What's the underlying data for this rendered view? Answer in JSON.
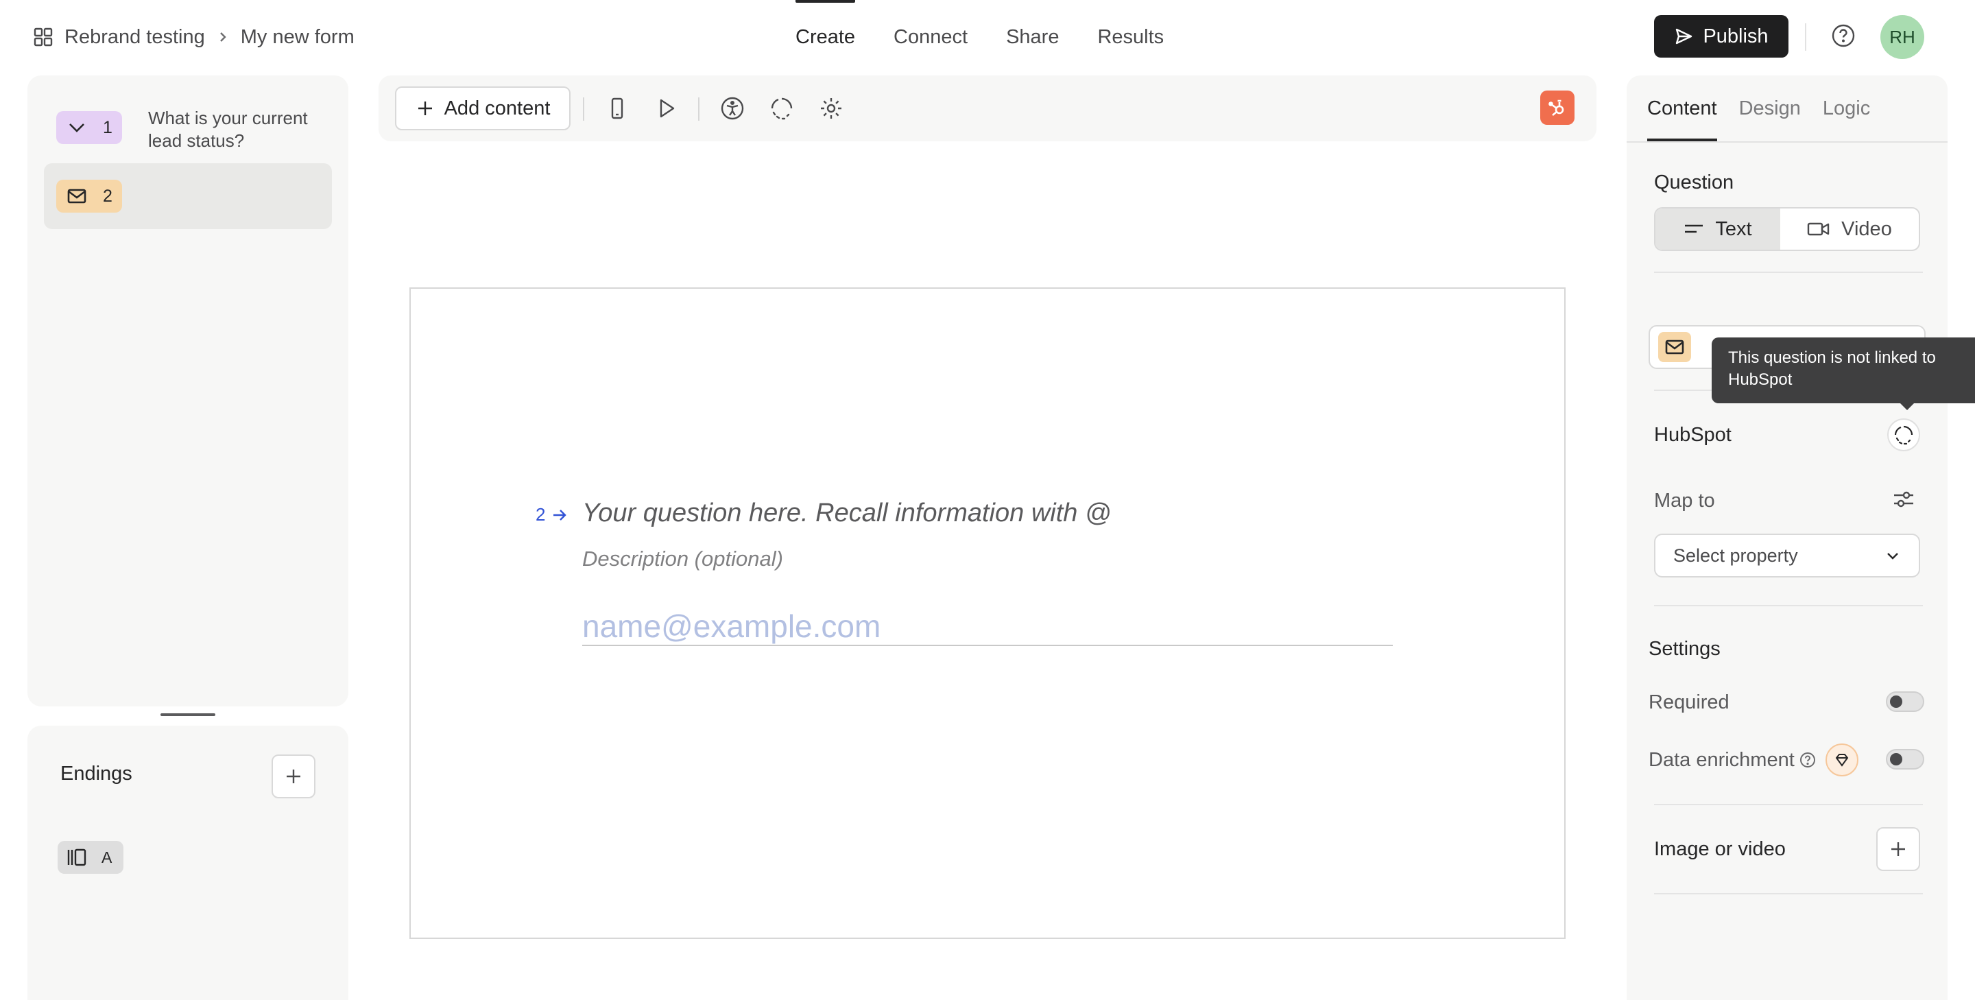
{
  "header": {
    "breadcrumb": {
      "workspace": "Rebrand testing",
      "form": "My new form"
    },
    "tabs": [
      {
        "label": "Create",
        "active": true
      },
      {
        "label": "Connect",
        "active": false
      },
      {
        "label": "Share",
        "active": false
      },
      {
        "label": "Results",
        "active": false
      }
    ],
    "publish_label": "Publish",
    "avatar_initials": "RH"
  },
  "questions": [
    {
      "number": "1",
      "text": "What is your current lead status?",
      "type_icon": "chevron-down-icon",
      "color": "#e5d0f5"
    },
    {
      "number": "2",
      "text": "",
      "type_icon": "mail-icon",
      "color": "#f7d7a8",
      "selected": true
    }
  ],
  "endings": {
    "title": "Endings",
    "items": [
      {
        "label": "A",
        "icon": "ending-icon"
      }
    ]
  },
  "toolbar": {
    "add_content_label": "Add content",
    "icons": [
      "mobile-icon",
      "play-icon",
      "accessibility-icon",
      "unlink-icon",
      "settings-icon",
      "hubspot-icon"
    ]
  },
  "canvas": {
    "question_number": "2",
    "question_placeholder": "Your question here. Recall information with @",
    "description_placeholder": "Description (optional)",
    "answer_placeholder": "name@example.com"
  },
  "right_panel": {
    "tabs": [
      {
        "label": "Content",
        "active": true
      },
      {
        "label": "Design",
        "active": false
      },
      {
        "label": "Logic",
        "active": false
      }
    ],
    "question_label": "Question",
    "question_modes": [
      {
        "label": "Text",
        "selected": true
      },
      {
        "label": "Video",
        "selected": false
      }
    ],
    "hubspot_label": "HubSpot",
    "map_to_label": "Map to",
    "select_placeholder": "Select property",
    "settings_label": "Settings",
    "required_label": "Required",
    "required_on": false,
    "data_enrichment_label": "Data enrichment",
    "data_enrichment_on": false,
    "image_video_label": "Image or video",
    "tooltip": "This question is not linked to HubSpot"
  },
  "colors": {
    "publish_bg": "#1f1f20",
    "avatar_bg": "#a9dcb0",
    "hubspot_orange": "#f06e4e",
    "link_blue": "#3253d6"
  }
}
